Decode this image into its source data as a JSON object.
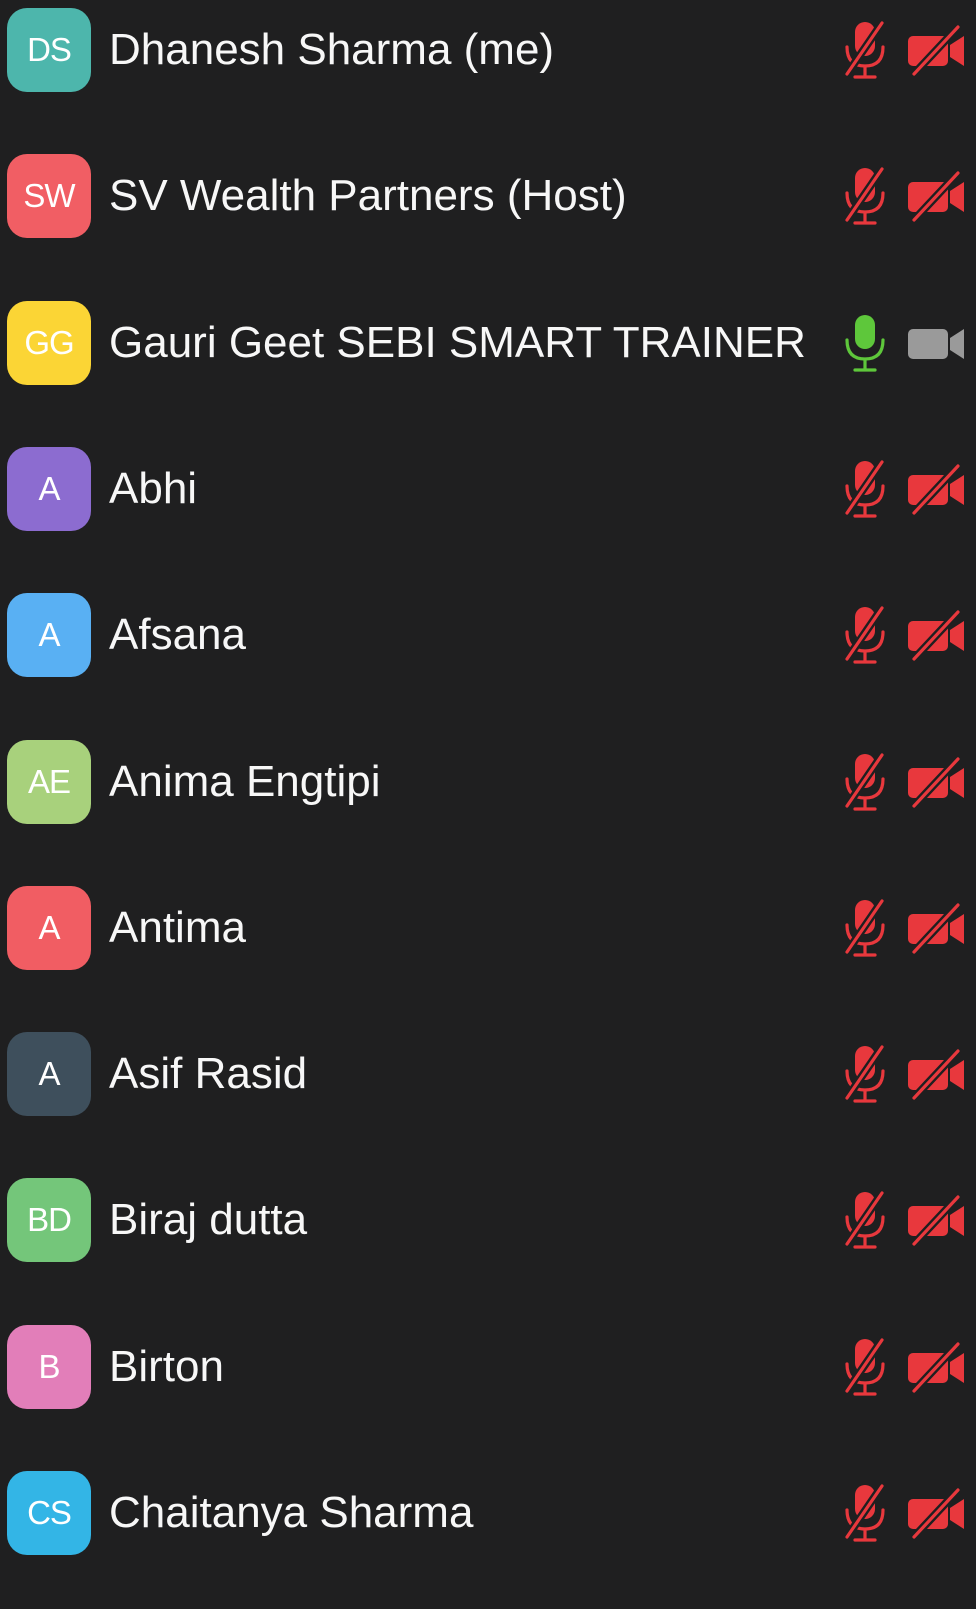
{
  "participants": [
    {
      "initials": "DS",
      "name": "Dhanesh Sharma",
      "tag": "(me)",
      "avatar_color": "#4db6ac",
      "mic": "muted",
      "camera": "off"
    },
    {
      "initials": "SW",
      "name": "SV Wealth Partners",
      "tag": "(Host)",
      "avatar_color": "#f15e64",
      "mic": "muted",
      "camera": "off"
    },
    {
      "initials": "GG",
      "name": "Gauri Geet SEBI SMART TRAINER",
      "tag": "",
      "avatar_color": "#fbd535",
      "mic": "active",
      "camera": "on"
    },
    {
      "initials": "A",
      "name": "Abhi",
      "tag": "",
      "avatar_color": "#8c6cd0",
      "mic": "muted",
      "camera": "off"
    },
    {
      "initials": "A",
      "name": "Afsana",
      "tag": "",
      "avatar_color": "#59b0f3",
      "mic": "muted",
      "camera": "off"
    },
    {
      "initials": "AE",
      "name": "Anima Engtipi",
      "tag": "",
      "avatar_color": "#a8d17c",
      "mic": "muted",
      "camera": "off"
    },
    {
      "initials": "A",
      "name": "Antima",
      "tag": "",
      "avatar_color": "#f15d63",
      "mic": "muted",
      "camera": "off"
    },
    {
      "initials": "A",
      "name": "Asif Rasid",
      "tag": "",
      "avatar_color": "#3e4f5c",
      "mic": "muted",
      "camera": "off"
    },
    {
      "initials": "BD",
      "name": "Biraj dutta",
      "tag": "",
      "avatar_color": "#74c67a",
      "mic": "muted",
      "camera": "off"
    },
    {
      "initials": "B",
      "name": "Birton",
      "tag": "",
      "avatar_color": "#e27eb9",
      "mic": "muted",
      "camera": "off"
    },
    {
      "initials": "CS",
      "name": "Chaitanya Sharma",
      "tag": "",
      "avatar_color": "#33b5e6",
      "mic": "muted",
      "camera": "off"
    }
  ],
  "status_colors": {
    "muted": "#e8383d",
    "active": "#5ec73b",
    "camera_on": "#9a9a9a"
  },
  "icons": {
    "mic_muted": "mic-muted-icon",
    "mic_active": "mic-icon",
    "camera_off": "camera-off-icon",
    "camera_on": "camera-icon"
  }
}
